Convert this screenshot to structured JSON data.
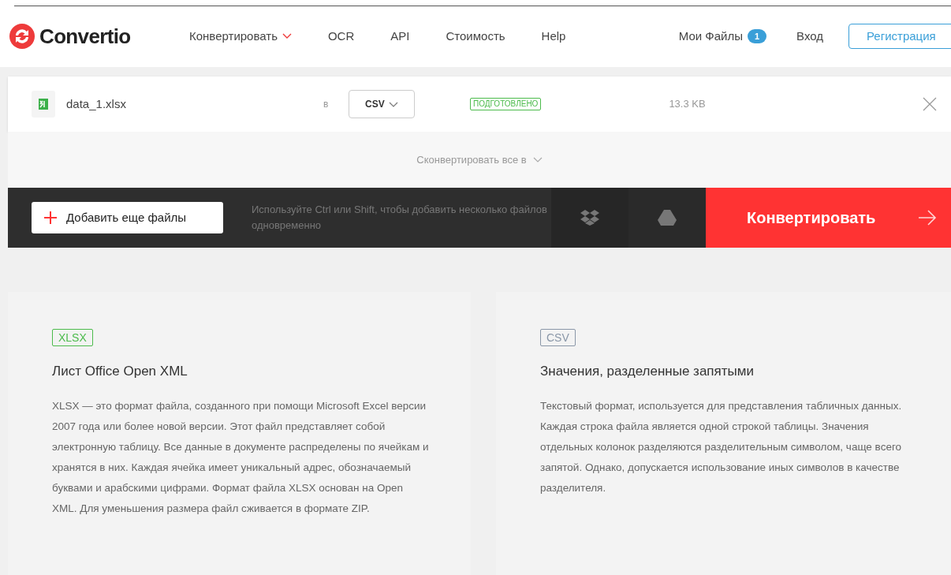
{
  "header": {
    "logo": "Convertio",
    "nav": [
      {
        "label": "Конвертировать",
        "dropdown": true
      },
      {
        "label": "OCR",
        "dropdown": false
      },
      {
        "label": "API",
        "dropdown": false
      },
      {
        "label": "Стоимость",
        "dropdown": false
      },
      {
        "label": "Help",
        "dropdown": false
      }
    ],
    "my_files": {
      "label": "Мои Файлы",
      "count": "1"
    },
    "login": "Вход",
    "register": "Регистрация"
  },
  "file": {
    "name": "data_1.xlsx",
    "to_label": "в",
    "format": "CSV",
    "status": "ПОДГОТОВЛЕНО",
    "size": "13.3 KB"
  },
  "convert_all": "Сконвертировать все в",
  "toolbar": {
    "add_button": "Добавить еще файлы",
    "hint": "Используйте Ctrl или Shift, чтобы добавить несколько файлов одновременно",
    "convert_button": "Конвертировать"
  },
  "formats": [
    {
      "tag": "XLSX",
      "color": "#4cbb4c",
      "title": "Лист Office Open XML",
      "description": "XLSX — это формат файла, созданного при помощи Microsoft Excel версии 2007 года или более новой версии. Этот файл представляет собой электронную таблицу. Все данные в документе распределены по ячейкам и хранятся в них. Каждая ячейка имеет уникальный адрес, обозначаемый буквами и арабскими цифрами. Формат файла XLSX основан на Open XML. Для уменьшения размера файл сживается в формате ZIP."
    },
    {
      "tag": "CSV",
      "color": "#8a97a8",
      "title": "Значения, разделенные запятыми",
      "description": "Текстовый формат, используется для представления табличных данных. Каждая строка файла является одной строкой таблицы. Значения отдельных колонок разделяются разделительным символом, чаще всего запятой. Однако, допускается использование иных символов в качестве разделителя."
    }
  ]
}
